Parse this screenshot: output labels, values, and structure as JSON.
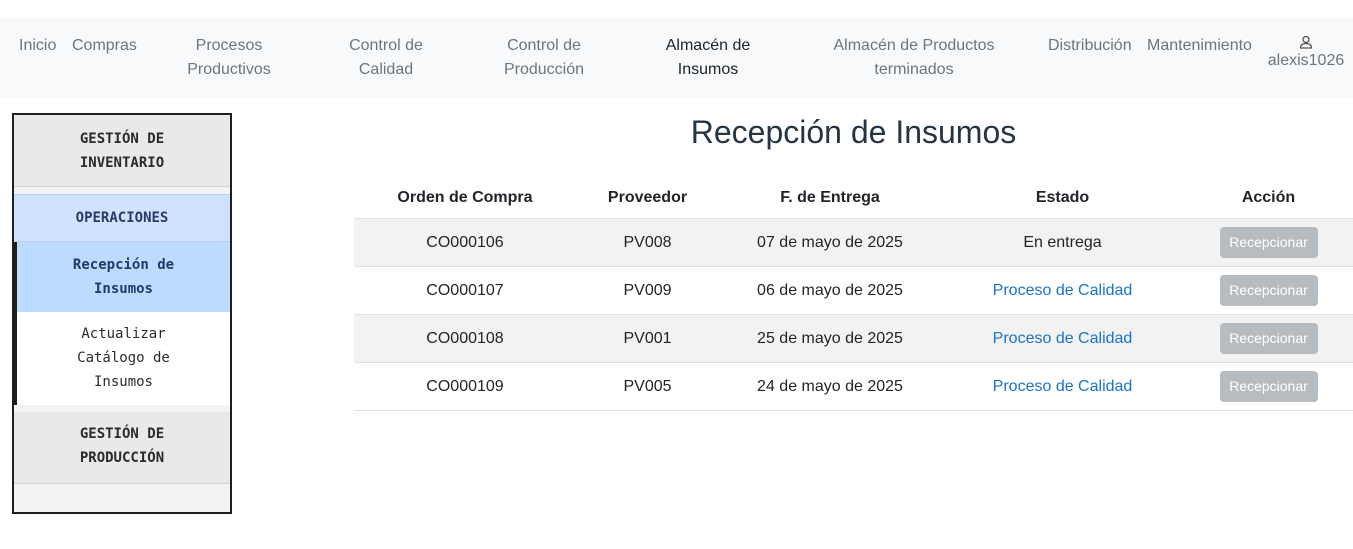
{
  "nav": {
    "items": [
      {
        "label": "Inicio"
      },
      {
        "label": "Compras"
      },
      {
        "label_line1": "Procesos",
        "label_line2": "Productivos"
      },
      {
        "label_line1": "Control de",
        "label_line2": "Calidad"
      },
      {
        "label_line1": "Control de",
        "label_line2": "Producción"
      },
      {
        "label_line1": "Almacén de",
        "label_line2": "Insumos"
      },
      {
        "label_line1": "Almacén de Productos",
        "label_line2": "terminados"
      },
      {
        "label": "Distribución"
      },
      {
        "label": "Mantenimiento"
      }
    ],
    "user": {
      "name": "alexis1026",
      "icon": "user-icon"
    }
  },
  "sidebar": {
    "inventory_header": {
      "line1": "GESTIÓN DE",
      "line2": "INVENTARIO"
    },
    "operations_label": "OPERACIONES",
    "items": [
      {
        "line1": "Recepción de",
        "line2": "Insumos"
      },
      {
        "line1": "Actualizar",
        "line2": "Catálogo de",
        "line3": "Insumos"
      }
    ],
    "production_header": {
      "line1": "GESTIÓN DE",
      "line2": "PRODUCCIÓN"
    }
  },
  "main": {
    "title": "Recepción de Insumos",
    "columns": [
      "Orden de Compra",
      "Proveedor",
      "F. de Entrega",
      "Estado",
      "Acción"
    ],
    "rows": [
      {
        "order": "CO000106",
        "supplier": "PV008",
        "date": "07 de mayo de 2025",
        "status": "En entrega",
        "action": "Recepcionar"
      },
      {
        "order": "CO000107",
        "supplier": "PV009",
        "date": "06 de mayo de 2025",
        "status": "Proceso de Calidad",
        "action": "Recepcionar"
      },
      {
        "order": "CO000108",
        "supplier": "PV001",
        "date": "25 de mayo de 2025",
        "status": "Proceso de Calidad",
        "action": "Recepcionar"
      },
      {
        "order": "CO000109",
        "supplier": "PV005",
        "date": "24 de mayo de 2025",
        "status": "Proceso de Calidad",
        "action": "Recepcionar"
      }
    ]
  },
  "colors": {
    "nav_bg": "#f8f9fa",
    "sidebar_active": "#bddbff",
    "link": "#1a73c9",
    "button_disabled": "#b7bcc1"
  }
}
